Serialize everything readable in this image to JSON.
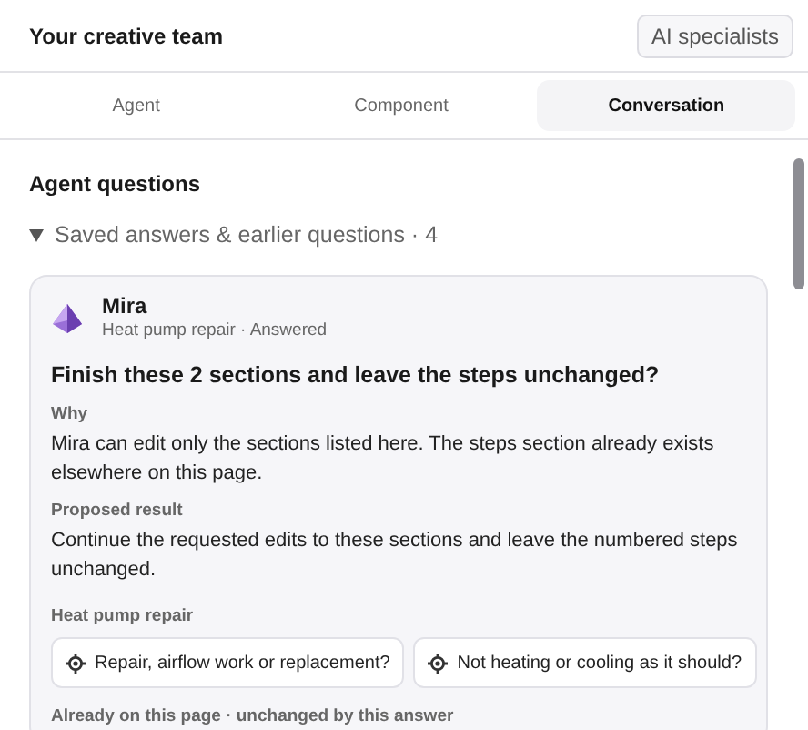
{
  "header": {
    "title": "Your creative team",
    "button": "AI specialists"
  },
  "tabs": [
    {
      "label": "Agent",
      "selected": false
    },
    {
      "label": "Component",
      "selected": false
    },
    {
      "label": "Conversation",
      "selected": true
    }
  ],
  "section": {
    "title": "Agent questions",
    "disclosure": {
      "label": "Saved answers & earlier questions · 4",
      "expanded": true
    }
  },
  "card": {
    "agent": "Mira",
    "meta": "Heat pump repair · Answered",
    "question": "Finish these 2 sections and leave the steps unchanged?",
    "blocks": [
      {
        "label": "Why",
        "text": "Mira can edit only the sections listed here. The steps section already exists elsewhere on this page."
      },
      {
        "label": "Proposed result",
        "text": "Continue the requested edits to these sections and leave the numbered steps unchanged."
      }
    ],
    "group_label": "Heat pump repair",
    "chips": [
      {
        "label": "Repair, airflow work or replacement?"
      },
      {
        "label": "Not heating or cooling as it should?"
      }
    ],
    "footer_label": "Already on this page · unchanged by this answer"
  }
}
